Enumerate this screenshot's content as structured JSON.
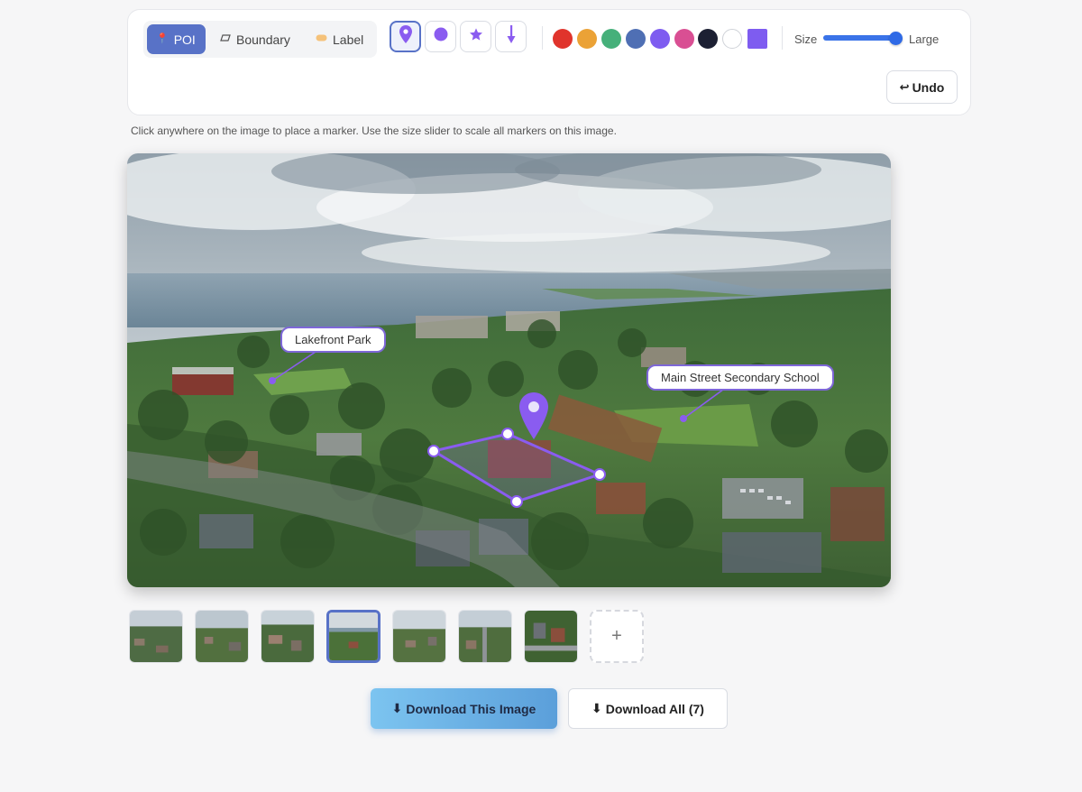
{
  "toolbar": {
    "modes": [
      {
        "label": "POI",
        "icon": "pin-icon",
        "active": true
      },
      {
        "label": "Boundary",
        "icon": "polygon-icon",
        "active": false
      },
      {
        "label": "Label",
        "icon": "tag-icon",
        "active": false
      }
    ],
    "marker_styles": [
      "pin",
      "dot",
      "star",
      "arrow"
    ],
    "active_marker_style": "pin",
    "colors": [
      "#e0342c",
      "#eba236",
      "#46b07a",
      "#4f6fb4",
      "#7e5cf0",
      "#d94f93",
      "#1c2033",
      "#ffffff",
      "#7e5cf0"
    ],
    "active_color": "#7e5cf0",
    "size": {
      "label": "Size",
      "value_label": "Large",
      "level": 1.0
    },
    "undo_label": "Undo"
  },
  "hint": "Click anywhere on the image to place a marker. Use the size slider to scale all markers on this image.",
  "canvas": {
    "labels": [
      "Lakefront Park",
      "Main Street Secondary School"
    ],
    "marker_color": "#8a5cf0"
  },
  "thumbnails": {
    "count": 7,
    "active_index": 3,
    "add_label": "+"
  },
  "actions": {
    "download_this": "Download This Image",
    "download_all": "Download All (7)"
  }
}
